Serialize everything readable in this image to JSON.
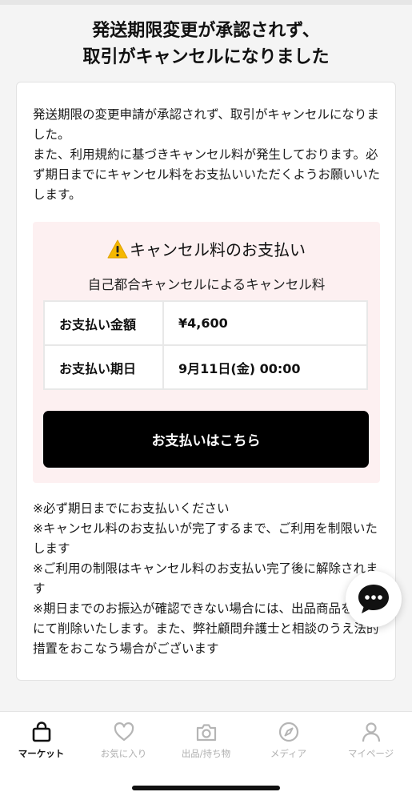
{
  "header": {
    "title": "発送期限変更が承認されず、\n取引がキャンセルになりました"
  },
  "card": {
    "description": "発送期限の変更申請が承認されず、取引がキャンセルになりました。\nまた、利用規約に基づきキャンセル料が発生しております。必ず期日までにキャンセル料をお支払いいただくようお願いいたします。",
    "payment": {
      "title": "キャンセル料のお支払い",
      "subtitle": "自己都合キャンセルによるキャンセル料",
      "amount_label": "お支払い金額",
      "amount_value": "¥4,600",
      "due_label": "お支払い期日",
      "due_value": "9月11日(金) 00:00",
      "button_label": "お支払いはこちら",
      "warning_color": "#f5b800"
    },
    "notes": [
      "※必ず期日までにお支払いください",
      "※キャンセル料のお支払いが完了するまで、ご利用を制限いたします",
      "※ご利用の制限はキャンセル料のお支払い完了後に解除されます",
      "※期日までのお振込が確認できない場合には、出品商品を運営にて削除いたします。また、弊社顧問弁護士と相談のうえ法的措置をおこなう場合がございます"
    ]
  },
  "chat": {
    "icon": "chat-bubble-icon"
  },
  "tabbar": {
    "tabs": [
      {
        "label": "マーケット",
        "icon": "shopping-bag-icon",
        "active": true
      },
      {
        "label": "お気に入り",
        "icon": "heart-icon",
        "active": false
      },
      {
        "label": "出品/持ち物",
        "icon": "camera-icon",
        "active": false
      },
      {
        "label": "メディア",
        "icon": "compass-icon",
        "active": false
      },
      {
        "label": "マイページ",
        "icon": "person-icon",
        "active": false
      }
    ]
  }
}
